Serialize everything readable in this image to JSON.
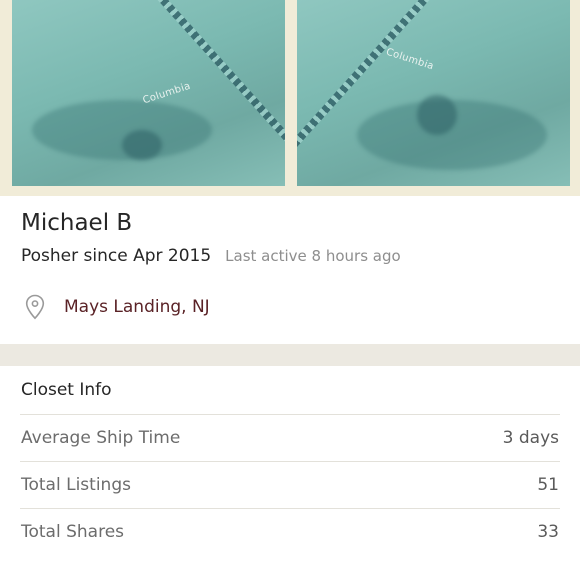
{
  "cover": {
    "left_logo": "Columbia",
    "right_logo": "Columbia"
  },
  "profile": {
    "name": "Michael B",
    "posher_since": "Posher since Apr 2015",
    "last_active": "Last active 8 hours ago",
    "location_icon": "map-pin-icon",
    "location": "Mays Landing, NJ"
  },
  "closet_info": {
    "title": "Closet Info",
    "rows": [
      {
        "label": "Average Ship Time",
        "value": "3 days"
      },
      {
        "label": "Total Listings",
        "value": "51"
      },
      {
        "label": "Total Shares",
        "value": "33"
      }
    ]
  },
  "colors": {
    "location_text": "#5a2226",
    "muted_text": "#8e8e8e",
    "cover_teal": "#7bb9b1"
  }
}
